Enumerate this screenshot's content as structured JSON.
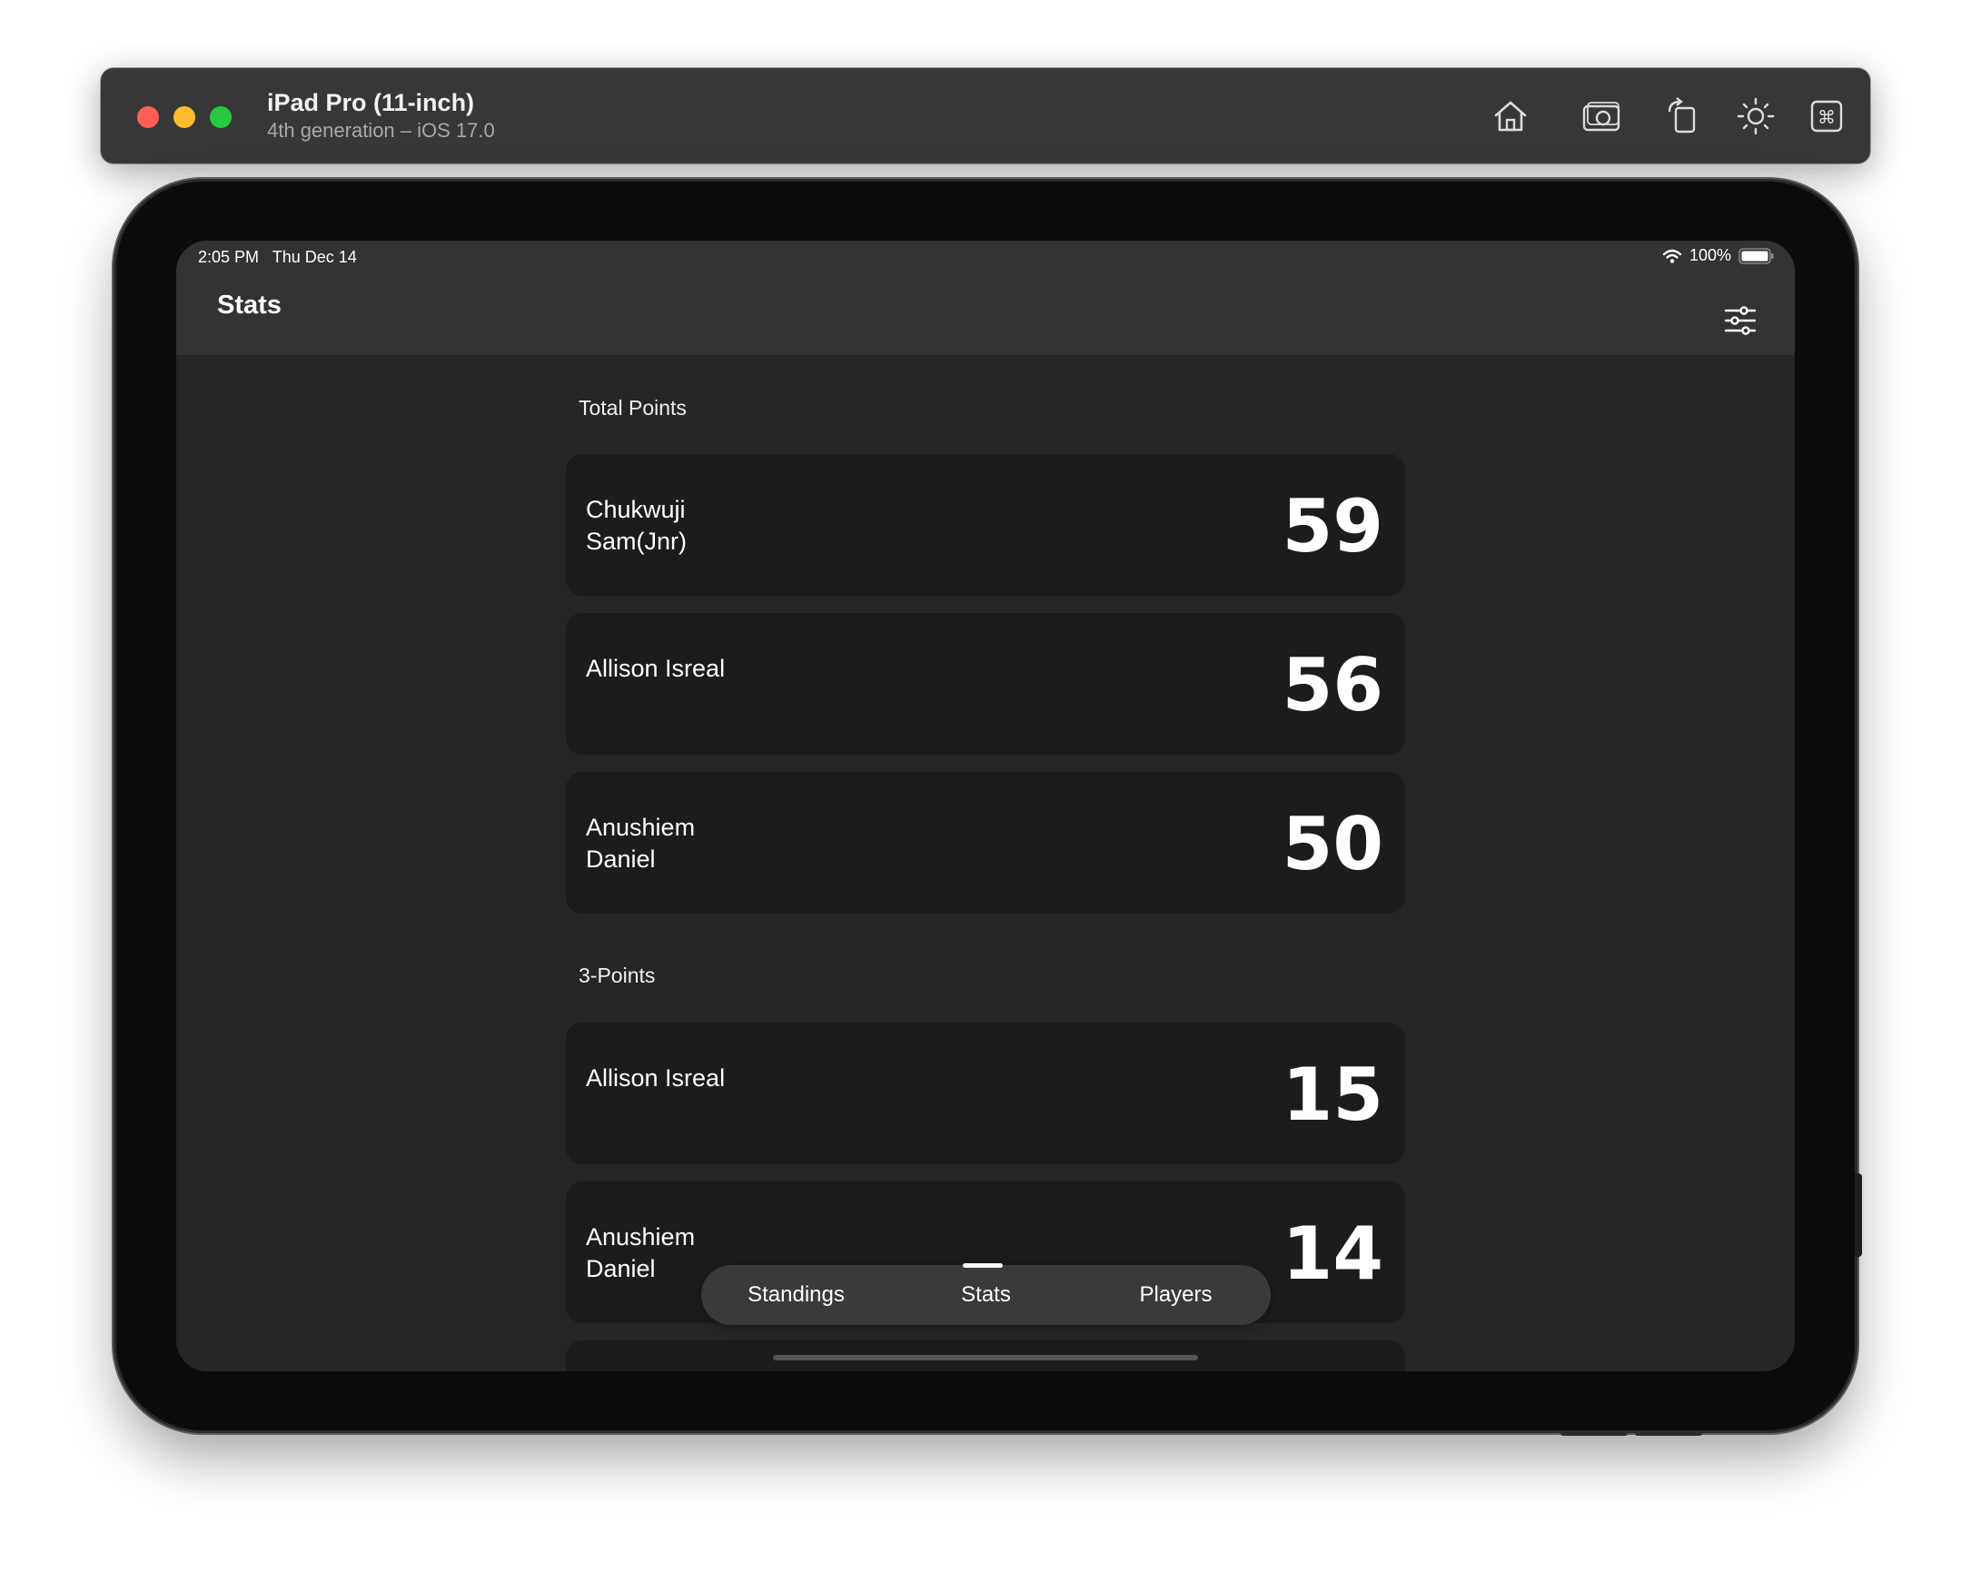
{
  "simulator": {
    "device_name": "iPad Pro (11-inch)",
    "device_subtitle": "4th generation – iOS 17.0",
    "toolbar_icons": [
      "home-icon",
      "screenshot-icon",
      "rotate-icon",
      "appearance-icon",
      "command-icon"
    ]
  },
  "status_bar": {
    "time_date": "2:05 PM   Thu Dec 14",
    "battery": "100%"
  },
  "nav": {
    "title": "Stats"
  },
  "sections": [
    {
      "title": "Total Points",
      "rows": [
        {
          "name": "Chukwuji Sam(Jnr)",
          "value": "59"
        },
        {
          "name": "Allison Isreal",
          "value": "56"
        },
        {
          "name": "Anushiem Daniel",
          "value": "50"
        }
      ]
    },
    {
      "title": "3-Points",
      "rows": [
        {
          "name": "Allison Isreal",
          "value": "15"
        },
        {
          "name": "Anushiem Daniel",
          "value": "14"
        }
      ]
    }
  ],
  "tabs": [
    {
      "label": "Standings"
    },
    {
      "label": "Stats"
    },
    {
      "label": "Players"
    }
  ],
  "selected_tab": "Stats",
  "colors": {
    "screen_background": "#262626",
    "bar_background": "#333333",
    "card_background": "#1c1c1c",
    "text": "#ffffff"
  }
}
